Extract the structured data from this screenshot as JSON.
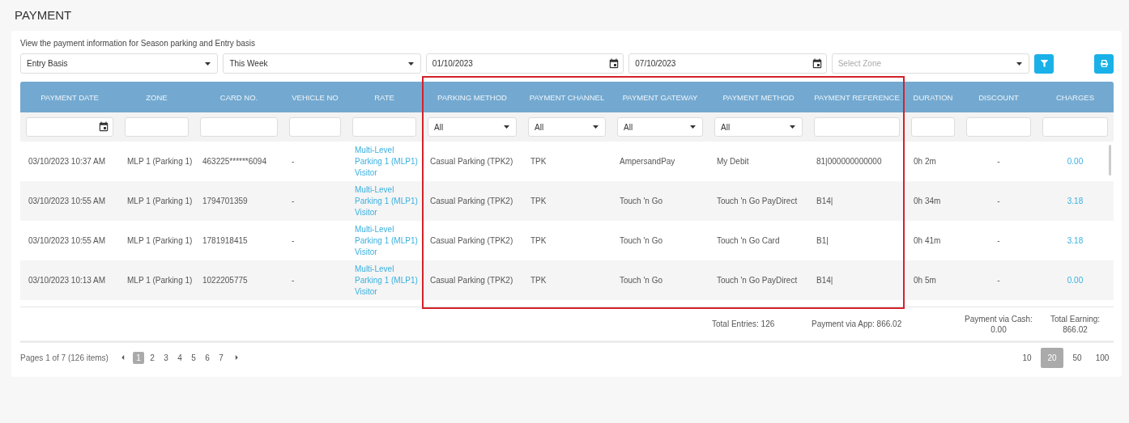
{
  "page": {
    "title": "PAYMENT"
  },
  "card": {
    "description": "View the payment information for Season parking and Entry basis",
    "filters": [
      {
        "kind": "select",
        "value": "Entry Basis"
      },
      {
        "kind": "select",
        "value": "This Week"
      },
      {
        "kind": "date",
        "value": "01/10/2023"
      },
      {
        "kind": "date",
        "value": "07/10/2023"
      },
      {
        "kind": "select",
        "placeholder": "Select Zone"
      }
    ]
  },
  "table": {
    "columns": [
      {
        "label": "PAYMENT DATE",
        "kind": "text",
        "highlighted": false,
        "filter": {
          "kind": "date"
        }
      },
      {
        "label": "ZONE",
        "kind": "text",
        "highlighted": false,
        "filter": {
          "kind": "text"
        }
      },
      {
        "label": "CARD NO.",
        "kind": "text",
        "highlighted": false,
        "filter": {
          "kind": "text"
        }
      },
      {
        "label": "VEHICLE NO",
        "kind": "text",
        "highlighted": false,
        "filter": {
          "kind": "text"
        }
      },
      {
        "label": "RATE",
        "kind": "link",
        "highlighted": false,
        "filter": {
          "kind": "text"
        }
      },
      {
        "label": "PARKING METHOD",
        "kind": "text",
        "highlighted": true,
        "filter": {
          "kind": "select",
          "value": "All"
        }
      },
      {
        "label": "PAYMENT CHANNEL",
        "kind": "text",
        "highlighted": true,
        "filter": {
          "kind": "select",
          "value": "All"
        }
      },
      {
        "label": "PAYMENT GATEWAY",
        "kind": "text",
        "highlighted": true,
        "filter": {
          "kind": "select",
          "value": "All"
        }
      },
      {
        "label": "PAYMENT METHOD",
        "kind": "text",
        "highlighted": true,
        "filter": {
          "kind": "select",
          "value": "All"
        }
      },
      {
        "label": "PAYMENT REFERENCE",
        "kind": "text",
        "highlighted": true,
        "filter": {
          "kind": "text"
        }
      },
      {
        "label": "DURATION",
        "kind": "text",
        "highlighted": false,
        "filter": {
          "kind": "text"
        }
      },
      {
        "label": "DISCOUNT",
        "kind": "centered",
        "highlighted": false,
        "filter": {
          "kind": "text"
        }
      },
      {
        "label": "CHARGES",
        "kind": "centered-link",
        "highlighted": false,
        "filter": {
          "kind": "text"
        }
      }
    ],
    "rows": [
      [
        "03/10/2023 10:37 AM",
        "MLP 1 (Parking 1)",
        "463225******6094",
        "-",
        "Multi-Level Parking 1 (MLP1) Visitor",
        "Casual Parking (TPK2)",
        "TPK",
        "AmpersandPay",
        "My Debit",
        "81|000000000000",
        "0h 2m",
        "-",
        "0.00"
      ],
      [
        "03/10/2023 10:55 AM",
        "MLP 1 (Parking 1)",
        "1794701359",
        "-",
        "Multi-Level Parking 1 (MLP1) Visitor",
        "Casual Parking (TPK2)",
        "TPK",
        "Touch 'n Go",
        "Touch 'n Go PayDirect",
        "B14|",
        "0h 34m",
        "-",
        "3.18"
      ],
      [
        "03/10/2023 10:55 AM",
        "MLP 1 (Parking 1)",
        "1781918415",
        "-",
        "Multi-Level Parking 1 (MLP1) Visitor",
        "Casual Parking (TPK2)",
        "TPK",
        "Touch 'n Go",
        "Touch 'n Go Card",
        "B1|",
        "0h 41m",
        "-",
        "3.18"
      ],
      [
        "03/10/2023 10:13 AM",
        "MLP 1 (Parking 1)",
        "1022205775",
        "-",
        "Multi-Level Parking 1 (MLP1) Visitor",
        "Casual Parking (TPK2)",
        "TPK",
        "Touch 'n Go",
        "Touch 'n Go PayDirect",
        "B14|",
        "0h 5m",
        "-",
        "0.00"
      ]
    ],
    "totals": {
      "entries": "Total Entries: 126",
      "app": "Payment via App: 866.02",
      "cash": {
        "label": "Payment via Cash:",
        "value": "0.00"
      },
      "earning": {
        "label": "Total Earning:",
        "value": "866.02"
      }
    }
  },
  "pagination": {
    "summary": "Pages 1 of 7 (126 items)",
    "pages": [
      {
        "label": "1",
        "selected": true
      },
      {
        "label": "2",
        "selected": false
      },
      {
        "label": "3",
        "selected": false
      },
      {
        "label": "4",
        "selected": false
      },
      {
        "label": "5",
        "selected": false
      },
      {
        "label": "6",
        "selected": false
      },
      {
        "label": "7",
        "selected": false
      }
    ],
    "page_sizes": [
      {
        "label": "10",
        "selected": false
      },
      {
        "label": "20",
        "selected": true
      },
      {
        "label": "50",
        "selected": false
      },
      {
        "label": "100",
        "selected": false
      }
    ]
  }
}
